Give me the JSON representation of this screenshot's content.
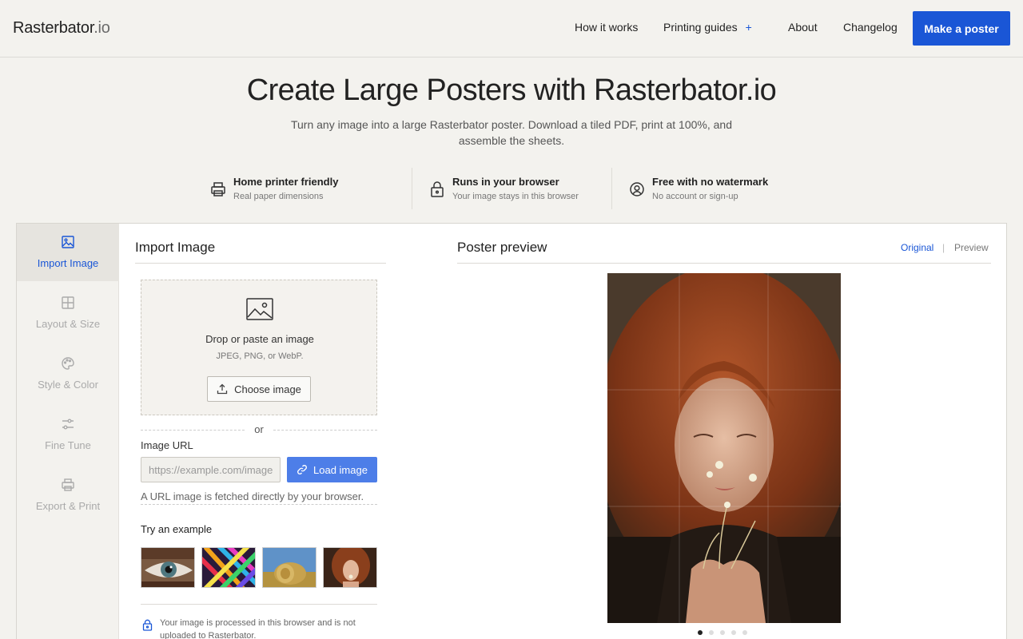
{
  "header": {
    "logo_main": "Rasterbator",
    "logo_tld": ".io",
    "nav": {
      "how": "How it works",
      "guides": "Printing guides",
      "guides_plus": "+",
      "about": "About",
      "changelog": "Changelog"
    },
    "cta": "Make a poster"
  },
  "hero": {
    "title": "Create Large Posters with Rasterbator.io",
    "subtitle": "Turn any image into a large Rasterbator poster. Download a tiled PDF, print at 100%, and assemble the sheets."
  },
  "features": [
    {
      "title": "Home printer friendly",
      "desc": "Real paper dimensions",
      "icon": "printer-icon"
    },
    {
      "title": "Runs in your browser",
      "desc": "Your image stays in this browser",
      "icon": "lock-icon"
    },
    {
      "title": "Free with no watermark",
      "desc": "No account or sign-up",
      "icon": "user-circle-icon"
    }
  ],
  "sidebar": {
    "items": [
      {
        "label": "Import Image",
        "icon": "image-icon",
        "active": true
      },
      {
        "label": "Layout & Size",
        "icon": "grid-icon",
        "active": false
      },
      {
        "label": "Style & Color",
        "icon": "palette-icon",
        "active": false
      },
      {
        "label": "Fine Tune",
        "icon": "sliders-icon",
        "active": false
      },
      {
        "label": "Export & Print",
        "icon": "printer-icon",
        "active": false
      }
    ]
  },
  "import": {
    "title": "Import Image",
    "drop_title": "Drop or paste an image",
    "drop_formats": "JPEG, PNG, or WebP.",
    "choose_label": "Choose image",
    "or": "or",
    "url_label": "Image URL",
    "url_placeholder": "https://example.com/image.jpg",
    "url_value": "",
    "load_label": "Load image",
    "url_note": "A URL image is fetched directly by your browser.",
    "examples_title": "Try an example",
    "examples": [
      "eye-example",
      "colored-pencils-example",
      "hay-bale-example",
      "girl-flowers-example"
    ],
    "privacy": "Your image is processed in this browser and is not uploaded to Rasterbator."
  },
  "preview": {
    "title": "Poster preview",
    "toggle_original": "Original",
    "toggle_sep": "|",
    "toggle_preview": "Preview",
    "page_dots": 5,
    "active_dot": 0
  },
  "colors": {
    "accent": "#1a56d6",
    "background": "#f3f2ee"
  }
}
